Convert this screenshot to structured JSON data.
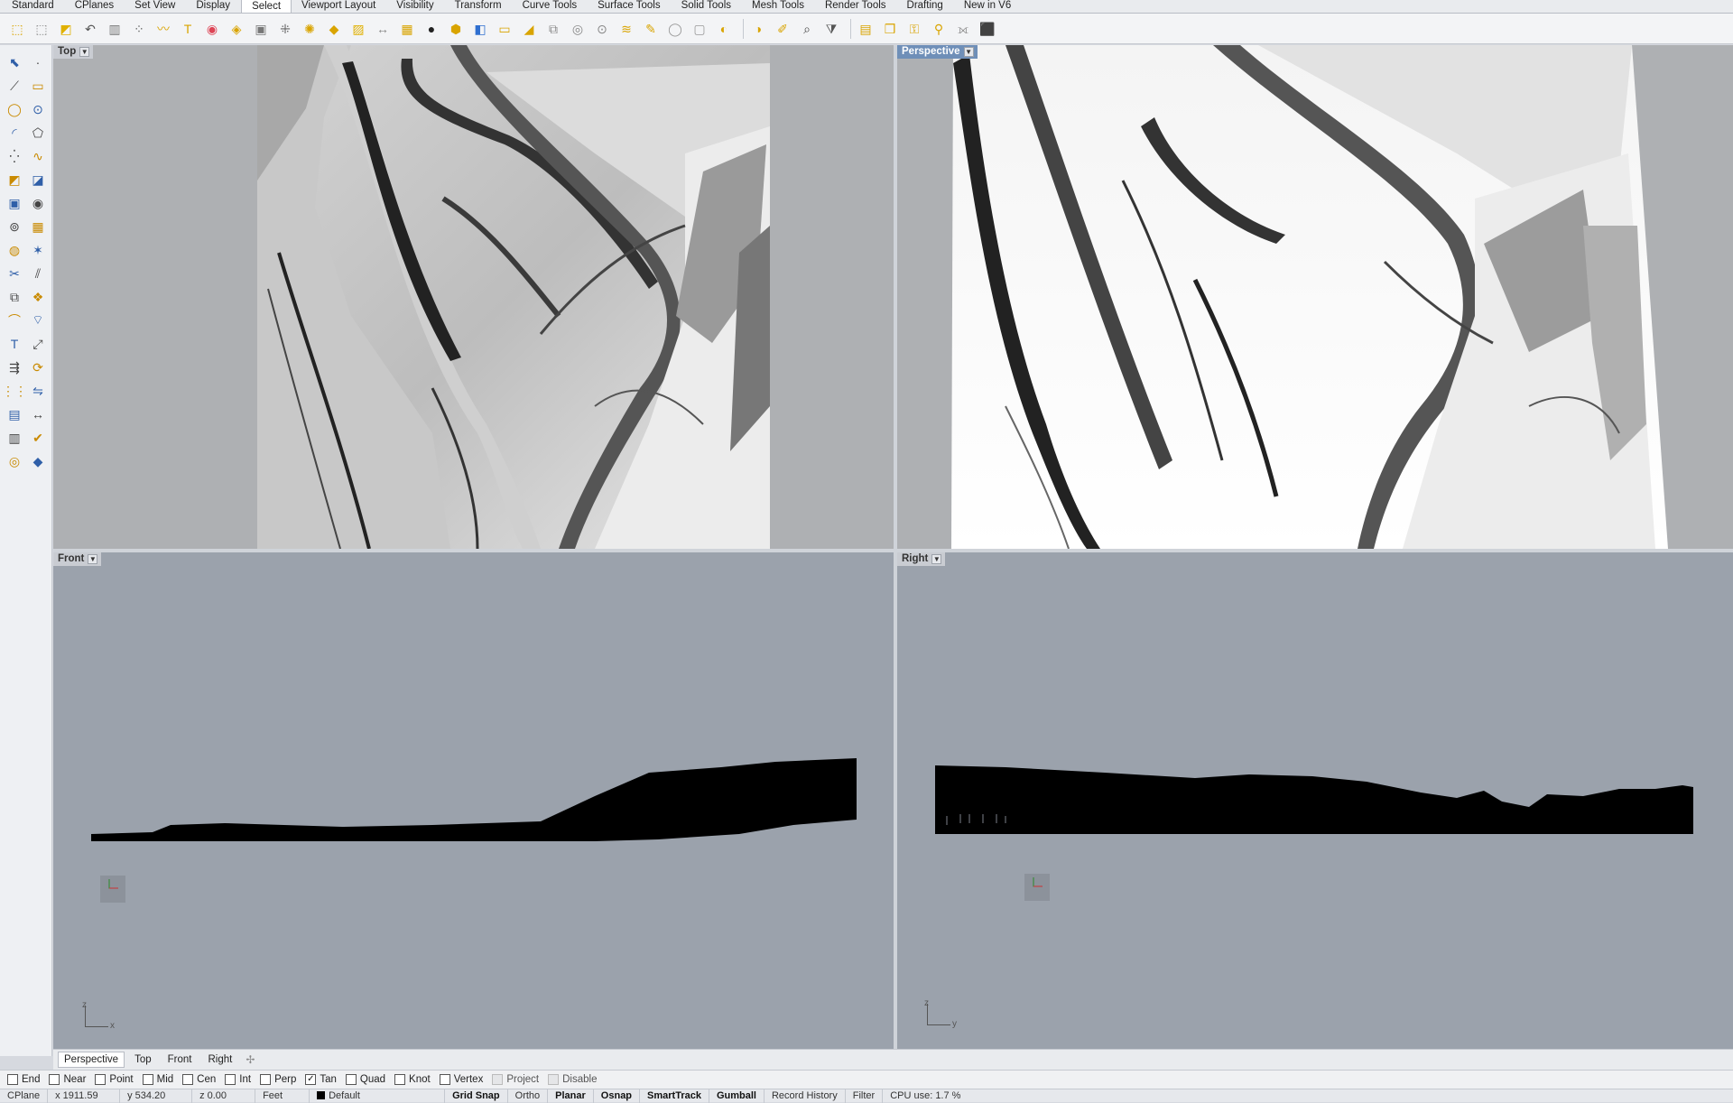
{
  "menu_tabs": [
    {
      "label": "Standard",
      "active": false
    },
    {
      "label": "CPlanes",
      "active": false
    },
    {
      "label": "Set View",
      "active": false
    },
    {
      "label": "Display",
      "active": false
    },
    {
      "label": "Select",
      "active": true
    },
    {
      "label": "Viewport Layout",
      "active": false
    },
    {
      "label": "Visibility",
      "active": false
    },
    {
      "label": "Transform",
      "active": false
    },
    {
      "label": "Curve Tools",
      "active": false
    },
    {
      "label": "Surface Tools",
      "active": false
    },
    {
      "label": "Solid Tools",
      "active": false
    },
    {
      "label": "Mesh Tools",
      "active": false
    },
    {
      "label": "Render Tools",
      "active": false
    },
    {
      "label": "Drafting",
      "active": false
    },
    {
      "label": "New in V6",
      "active": false
    }
  ],
  "toolbar_icons": [
    {
      "name": "select-all-icon",
      "glyph": "⬚",
      "color": "#d9a400"
    },
    {
      "name": "select-none-icon",
      "glyph": "⬚",
      "color": "#888888"
    },
    {
      "name": "select-last-icon",
      "glyph": "◩",
      "color": "#e0b000"
    },
    {
      "name": "select-previous-icon",
      "glyph": "↶",
      "color": "#555555"
    },
    {
      "name": "select-invert-icon",
      "glyph": "▥",
      "color": "#777777"
    },
    {
      "name": "select-points-icon",
      "glyph": "⁘",
      "color": "#666666"
    },
    {
      "name": "select-curves-icon",
      "glyph": "〰",
      "color": "#d9a400"
    },
    {
      "name": "select-text-icon",
      "glyph": "T",
      "color": "#d9a400"
    },
    {
      "name": "select-color-icon",
      "glyph": "◉",
      "color": "#dd4455"
    },
    {
      "name": "select-surfaces-icon",
      "glyph": "◈",
      "color": "#d9a400"
    },
    {
      "name": "select-polysurface-icon",
      "glyph": "▣",
      "color": "#777777"
    },
    {
      "name": "select-mesh-icon",
      "glyph": "⁜",
      "color": "#666666"
    },
    {
      "name": "select-lights-icon",
      "glyph": "✺",
      "color": "#d9a400"
    },
    {
      "name": "select-blocks-icon",
      "glyph": "◆",
      "color": "#d9a400"
    },
    {
      "name": "select-hatch-icon",
      "glyph": "▨",
      "color": "#e0b000"
    },
    {
      "name": "select-dimension-icon",
      "glyph": "↔",
      "color": "#888888"
    },
    {
      "name": "select-group-icon",
      "glyph": "▦",
      "color": "#d9a400"
    },
    {
      "name": "select-solid-icon",
      "glyph": "●",
      "color": "#222222"
    },
    {
      "name": "select-closed-icon",
      "glyph": "⬢",
      "color": "#d9a400"
    },
    {
      "name": "select-open-icon",
      "glyph": "◧",
      "color": "#2f6fd0"
    },
    {
      "name": "select-planar-icon",
      "glyph": "▭",
      "color": "#d9a400"
    },
    {
      "name": "select-degree-icon",
      "glyph": "◢",
      "color": "#d9a400"
    },
    {
      "name": "select-duplicates-icon",
      "glyph": "⧉",
      "color": "#888888"
    },
    {
      "name": "select-bad-objects-icon",
      "glyph": "◎",
      "color": "#888888"
    },
    {
      "name": "select-small-icon",
      "glyph": "⊙",
      "color": "#888888"
    },
    {
      "name": "select-layer-icon",
      "glyph": "≋",
      "color": "#d9a400"
    },
    {
      "name": "select-name-icon",
      "glyph": "✎",
      "color": "#d9a400"
    },
    {
      "name": "select-sphere-icon",
      "glyph": "◯",
      "color": "#999999"
    },
    {
      "name": "select-box-icon",
      "glyph": "▢",
      "color": "#999999"
    },
    {
      "name": "select-material-icon",
      "glyph": "◐",
      "color": "#d9a400"
    },
    {
      "name": "select-render-icon",
      "glyph": "◑",
      "color": "#d9a400"
    },
    {
      "name": "select-brush-icon",
      "glyph": "✐",
      "color": "#d9a400"
    },
    {
      "name": "zoom-selected-icon",
      "glyph": "⌕",
      "color": "#444444"
    },
    {
      "name": "filter-icon",
      "glyph": "⧩",
      "color": "#555555"
    },
    {
      "name": "select-fence-icon",
      "glyph": "▤",
      "color": "#d9a400"
    },
    {
      "name": "select-brep-icon",
      "glyph": "❒",
      "color": "#d9a400"
    },
    {
      "name": "select-key-icon",
      "glyph": "⚿",
      "color": "#d9a400"
    },
    {
      "name": "select-lock-icon",
      "glyph": "⚲",
      "color": "#d9a400"
    },
    {
      "name": "select-mirror-icon",
      "glyph": "⟗",
      "color": "#888888"
    },
    {
      "name": "select-cube-icon",
      "glyph": "⬛",
      "color": "#d9a400"
    }
  ],
  "left_tools": [
    [
      "arrow-select-icon",
      "point-icon"
    ],
    [
      "polyline-icon",
      "rectangle-icon"
    ],
    [
      "circle-icon",
      "ellipse-icon"
    ],
    [
      "arc-icon",
      "polygon-icon"
    ],
    [
      "point-cloud-icon",
      "curve-icon"
    ],
    [
      "surface-corner-icon",
      "surface-edge-icon"
    ],
    [
      "box-icon",
      "sphere-icon"
    ],
    [
      "cylinder-icon",
      "mesh-icon"
    ],
    [
      "boolean-icon",
      "explode-icon"
    ],
    [
      "trim-icon",
      "split-icon"
    ],
    [
      "group-icon",
      "block-icon"
    ],
    [
      "fillet-icon",
      "chamfer-icon"
    ],
    [
      "text-icon",
      "scale-icon"
    ],
    [
      "align-icon",
      "rotate-icon"
    ],
    [
      "array-icon",
      "mirror-icon"
    ],
    [
      "grid-icon",
      "dimension-icon"
    ],
    [
      "layer-icon",
      "check-icon"
    ],
    [
      "render-icon",
      "material-icon"
    ]
  ],
  "left_tool_glyphs": [
    [
      "⬉",
      "·"
    ],
    [
      "⟋",
      "▭"
    ],
    [
      "◯",
      "⊙"
    ],
    [
      "◜",
      "⬠"
    ],
    [
      "⁛",
      "∿"
    ],
    [
      "◩",
      "◪"
    ],
    [
      "▣",
      "◉"
    ],
    [
      "⊚",
      "▦"
    ],
    [
      "◍",
      "✶"
    ],
    [
      "✂",
      "⫽"
    ],
    [
      "⧉",
      "❖"
    ],
    [
      "⌒",
      "⌔"
    ],
    [
      "T",
      "⤢"
    ],
    [
      "⇶",
      "⟳"
    ],
    [
      "⋮⋮",
      "⇋"
    ],
    [
      "▤",
      "↔"
    ],
    [
      "▥",
      "✔"
    ],
    [
      "◎",
      "◆"
    ]
  ],
  "viewports": {
    "top": {
      "label": "Top",
      "axis_x": "",
      "axis_y": ""
    },
    "perspective": {
      "label": "Perspective",
      "active": true
    },
    "front": {
      "label": "Front",
      "axis_vertical": "z",
      "axis_horizontal": "x"
    },
    "right": {
      "label": "Right",
      "axis_vertical": "z",
      "axis_horizontal": "y"
    }
  },
  "viewport_tabs": [
    {
      "label": "Perspective",
      "active": true
    },
    {
      "label": "Top",
      "active": false
    },
    {
      "label": "Front",
      "active": false
    },
    {
      "label": "Right",
      "active": false
    }
  ],
  "viewport_tab_add": "✢",
  "osnaps": [
    {
      "label": "End",
      "checked": false,
      "disabled": false
    },
    {
      "label": "Near",
      "checked": false,
      "disabled": false
    },
    {
      "label": "Point",
      "checked": false,
      "disabled": false
    },
    {
      "label": "Mid",
      "checked": false,
      "disabled": false
    },
    {
      "label": "Cen",
      "checked": false,
      "disabled": false
    },
    {
      "label": "Int",
      "checked": false,
      "disabled": false
    },
    {
      "label": "Perp",
      "checked": false,
      "disabled": false
    },
    {
      "label": "Tan",
      "checked": true,
      "disabled": false
    },
    {
      "label": "Quad",
      "checked": false,
      "disabled": false
    },
    {
      "label": "Knot",
      "checked": false,
      "disabled": false
    },
    {
      "label": "Vertex",
      "checked": false,
      "disabled": false
    },
    {
      "label": "Project",
      "checked": false,
      "disabled": true
    },
    {
      "label": "Disable",
      "checked": false,
      "disabled": true
    }
  ],
  "status": {
    "cplane": "CPlane",
    "x": "x 1911.59",
    "y": "y 534.20",
    "z": "z 0.00",
    "units": "Feet",
    "layer": "Default",
    "grid_snap": "Grid Snap",
    "ortho": "Ortho",
    "planar": "Planar",
    "osnap": "Osnap",
    "smarttrack": "SmartTrack",
    "gumball": "Gumball",
    "record_history": "Record History",
    "filter": "Filter",
    "cpu": "CPU use: 1.7 %"
  },
  "colors": {
    "viewport_bg": "#9ba2ac",
    "active_label_bg": "#6f8fb8",
    "terrain_silhouette": "#000000"
  }
}
